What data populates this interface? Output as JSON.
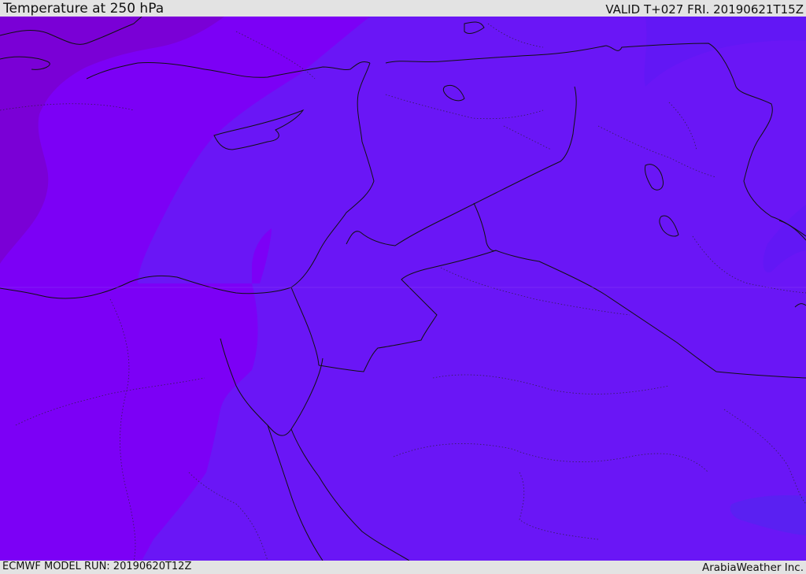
{
  "header": {
    "title": "Temperature at 250 hPa",
    "valid_time": "VALID T+027 FRI. 20190621T15Z"
  },
  "footer": {
    "model_run": "ECMWF MODEL RUN: 20190620T12Z",
    "credit": "ArabiaWeather Inc."
  },
  "map": {
    "fill_colors": {
      "darkest": "#7a00d6",
      "violet": "#7c00f6",
      "blue_violet": "#6a16f6",
      "indigo": "#5a20f2"
    }
  }
}
